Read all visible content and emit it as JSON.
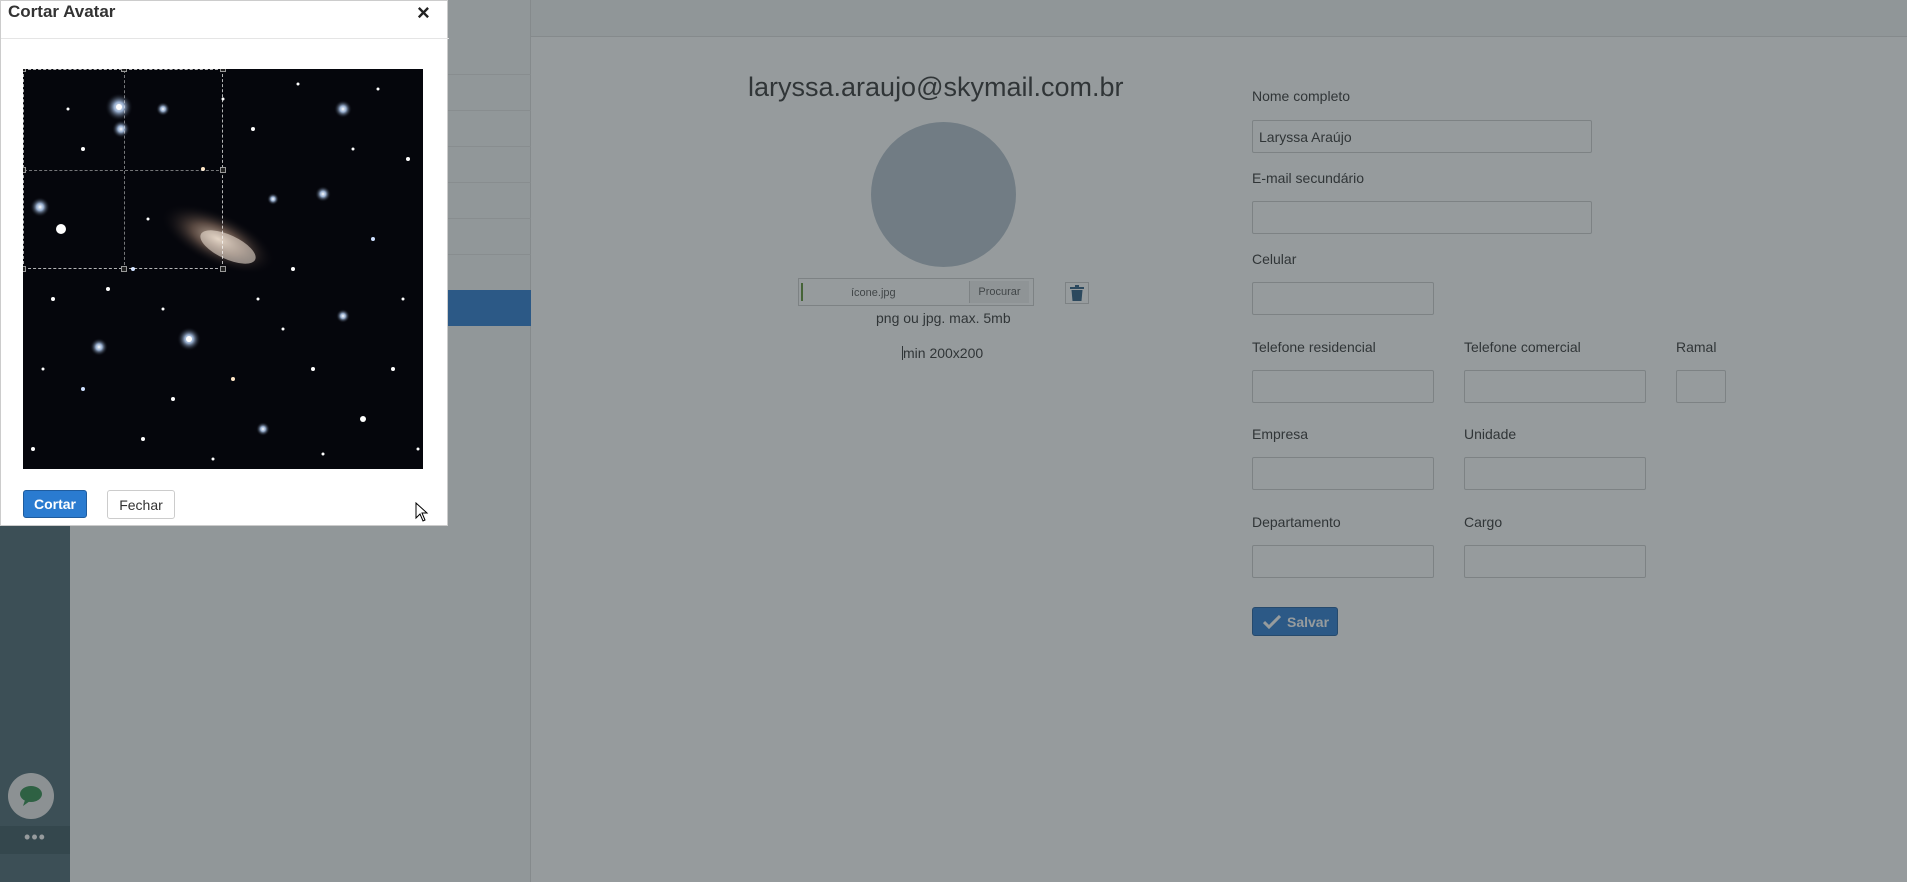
{
  "profile": {
    "email": "laryssa.araujo@skymail.com.br",
    "file_name": "ícone.jpg",
    "browse_label": "Procurar",
    "hint_format": "png ou jpg. max. 5mb",
    "hint_size": "min 200x200"
  },
  "form": {
    "full_name_label": "Nome completo",
    "full_name_value": "Laryssa Araújo",
    "secondary_email_label": "E-mail secundário",
    "cell_label": "Celular",
    "home_phone_label": "Telefone residencial",
    "work_phone_label": "Telefone comercial",
    "extension_label": "Ramal",
    "company_label": "Empresa",
    "unit_label": "Unidade",
    "department_label": "Departamento",
    "role_label": "Cargo",
    "save_label": "Salvar"
  },
  "modal": {
    "title": "Cortar Avatar",
    "close_glyph": "×",
    "crop_label": "Cortar",
    "close_label": "Fechar"
  },
  "rail": {
    "more_glyph": "•••"
  },
  "colors": {
    "primary": "#2a7bd0",
    "rail": "#4a6770",
    "overlay": "rgba(45,55,60,0.5)"
  }
}
